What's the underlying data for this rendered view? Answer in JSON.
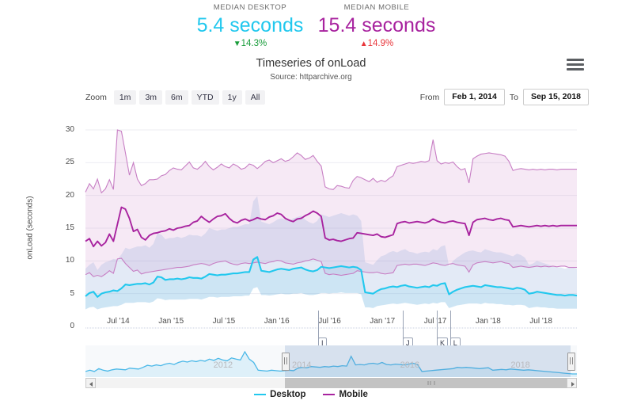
{
  "kpis": [
    {
      "name": "median-desktop",
      "label": "MEDIAN DESKTOP",
      "value": "5.4 seconds",
      "delta": "14.3%",
      "direction": "down",
      "arrow": "▼",
      "color": "#22c8ee",
      "delta_color": "#189c3a"
    },
    {
      "name": "median-mobile",
      "label": "MEDIAN MOBILE",
      "value": "15.4 seconds",
      "delta": "14.9%",
      "direction": "up",
      "arrow": "▲",
      "color": "#a8239f",
      "delta_color": "#e8353a"
    }
  ],
  "chart": {
    "title": "Timeseries of onLoad",
    "subtitle": "Source: httparchive.org",
    "menu_icon": "hamburger-menu-icon"
  },
  "rangeselector": {
    "label": "Zoom",
    "buttons": [
      "1m",
      "3m",
      "6m",
      "YTD",
      "1y",
      "All"
    ],
    "from_label": "From",
    "from_value": "Feb 1, 2014",
    "to_label": "To",
    "to_value": "Sep 15, 2018"
  },
  "navigator": {
    "years": [
      "2012",
      "2014",
      "2016",
      "2018"
    ],
    "left_handle": "navigator-left-handle",
    "right_handle": "navigator-right-handle",
    "scroll_left_icon": "arrow-left-icon",
    "scroll_right_icon": "arrow-right-icon"
  },
  "legend": [
    {
      "label": "Desktop",
      "color": "#22c8ee"
    },
    {
      "label": "Mobile",
      "color": "#a8239f"
    }
  ],
  "flags": [
    {
      "label": "I",
      "x": 0.4735
    },
    {
      "label": "J",
      "x": 0.6458
    },
    {
      "label": "K",
      "x": 0.715
    },
    {
      "label": "L",
      "x": 0.742
    }
  ],
  "chart_data": {
    "type": "line",
    "title": "Timeseries of onLoad",
    "subtitle": "Source: httparchive.org",
    "xlabel": "",
    "ylabel": "onLoad (seconds)",
    "ylim": [
      0,
      30
    ],
    "yticks": [
      0,
      5,
      10,
      15,
      20,
      25,
      30
    ],
    "grid": true,
    "legend_position": "bottom",
    "xticks": [
      "Jul '14",
      "Jan '15",
      "Jul '15",
      "Jan '16",
      "Jul '16",
      "Jan '17",
      "Jul '17",
      "Jan '18",
      "Jul '18"
    ],
    "x_start": "Feb 1, 2014",
    "x_end": "Sep 15, 2018",
    "series": [
      {
        "name": "Desktop",
        "color": "#22c8ee",
        "role": "median",
        "values": [
          4.6,
          5.1,
          5.3,
          4.5,
          5.0,
          5.2,
          5.3,
          5.5,
          5.4,
          5.8,
          6.4,
          6.3,
          6.4,
          6.5,
          6.5,
          6.6,
          6.4,
          6.7,
          7.6,
          7.5,
          7.1,
          7.2,
          7.2,
          7.3,
          7.2,
          7.3,
          7.5,
          7.4,
          7.4,
          7.3,
          7.6,
          8.0,
          7.9,
          7.8,
          7.9,
          7.9,
          8.0,
          8.1,
          8.1,
          8.2,
          8.3,
          8.3,
          10.2,
          10.6,
          8.5,
          8.4,
          8.3,
          8.5,
          8.7,
          8.8,
          8.7,
          8.6,
          8.8,
          8.9,
          9.0,
          8.7,
          8.5,
          8.4,
          8.6,
          9.1,
          9.0,
          8.9,
          9.0,
          9.1,
          9.2,
          9.1,
          9.0,
          9.1,
          9.0,
          8.6,
          5.2,
          5.1,
          5.0,
          5.4,
          5.7,
          5.8,
          6.0,
          6.1,
          6.0,
          6.2,
          6.3,
          6.1,
          6.0,
          5.9,
          6.0,
          6.1,
          6.0,
          6.3,
          6.2,
          6.5,
          6.6,
          4.9,
          5.3,
          5.6,
          5.8,
          6.0,
          6.1,
          6.2,
          6.1,
          6.0,
          6.3,
          6.2,
          6.1,
          6.0,
          6.0,
          5.9,
          5.8,
          5.7,
          5.9,
          5.8,
          5.6,
          5.0,
          5.1,
          5.3,
          5.2,
          5.1,
          5.0,
          4.9,
          4.8,
          4.8,
          4.7,
          4.8,
          4.8,
          4.7
        ]
      },
      {
        "name": "Mobile",
        "color": "#a8239f",
        "role": "median",
        "values": [
          13.0,
          13.4,
          12.2,
          13.0,
          12.3,
          12.8,
          14.1,
          13.0,
          15.6,
          18.2,
          17.9,
          16.5,
          14.5,
          14.8,
          13.6,
          13.2,
          13.9,
          14.2,
          14.3,
          14.5,
          14.6,
          14.9,
          14.7,
          15.0,
          15.1,
          15.3,
          15.4,
          15.9,
          16.1,
          16.8,
          16.3,
          15.9,
          16.4,
          16.8,
          16.9,
          17.2,
          16.5,
          16.0,
          15.8,
          16.2,
          16.4,
          16.1,
          16.3,
          16.6,
          16.4,
          16.3,
          16.7,
          16.9,
          17.3,
          17.1,
          16.5,
          16.2,
          16.0,
          16.4,
          16.5,
          16.9,
          17.2,
          17.6,
          17.3,
          16.8,
          13.5,
          13.2,
          13.3,
          13.1,
          13.0,
          13.2,
          13.4,
          13.5,
          14.3,
          14.2,
          14.1,
          14.0,
          13.9,
          14.1,
          13.7,
          13.6,
          13.8,
          14.0,
          15.7,
          15.9,
          16.0,
          15.8,
          15.9,
          16.0,
          15.9,
          15.8,
          16.0,
          16.4,
          16.1,
          15.9,
          15.8,
          16.0,
          16.1,
          15.9,
          15.8,
          15.7,
          13.9,
          15.9,
          16.3,
          16.4,
          16.5,
          16.3,
          16.2,
          16.4,
          16.5,
          16.3,
          16.2,
          15.2,
          15.3,
          15.4,
          15.3,
          15.2,
          15.3,
          15.4,
          15.3,
          15.4,
          15.3,
          15.4,
          15.3,
          15.4,
          15.4,
          15.4,
          15.4,
          15.4
        ]
      },
      {
        "name": "Mobile upper band",
        "color": "#c77ec4",
        "role": "band-upper",
        "values": [
          20.5,
          21.8,
          21.0,
          22.5,
          20.4,
          21.0,
          22.4,
          20.9,
          30.0,
          29.8,
          26.5,
          23.1,
          25.0,
          22.5,
          21.5,
          21.8,
          22.4,
          22.4,
          22.5,
          23.0,
          23.2,
          23.8,
          24.2,
          24.0,
          23.9,
          24.5,
          25.1,
          24.2,
          24.0,
          24.5,
          25.2,
          24.4,
          23.9,
          24.3,
          24.8,
          24.4,
          24.2,
          24.8,
          24.5,
          24.0,
          24.2,
          24.8,
          24.6,
          24.1,
          24.6,
          25.2,
          25.4,
          25.0,
          25.3,
          25.6,
          25.2,
          25.4,
          25.9,
          26.5,
          26.1,
          25.5,
          25.7,
          26.1,
          25.2,
          24.5,
          21.3,
          21.0,
          20.9,
          21.5,
          21.4,
          21.2,
          21.1,
          22.3,
          22.9,
          22.7,
          22.4,
          22.1,
          22.6,
          22.0,
          22.3,
          22.1,
          22.6,
          23.0,
          24.4,
          24.6,
          24.8,
          25.0,
          24.9,
          25.0,
          25.2,
          25.1,
          25.3,
          28.5,
          25.3,
          24.8,
          25.0,
          24.9,
          25.1,
          24.4,
          23.9,
          24.1,
          21.9,
          25.6,
          26.0,
          26.3,
          26.4,
          26.5,
          26.4,
          26.3,
          26.2,
          26.0,
          25.2,
          23.8,
          24.0,
          24.1,
          24.0,
          23.9,
          24.0,
          23.9,
          24.0,
          23.9,
          24.0,
          24.0,
          23.9,
          24.0,
          24.0,
          24.0,
          24.0,
          24.0
        ]
      },
      {
        "name": "Mobile lower band",
        "color": "#c77ec4",
        "role": "band-lower",
        "values": [
          7.9,
          8.2,
          7.6,
          7.8,
          7.6,
          8.0,
          8.5,
          8.1,
          10.3,
          10.4,
          9.6,
          9.0,
          8.4,
          8.6,
          8.0,
          8.2,
          8.3,
          8.4,
          8.5,
          8.6,
          8.7,
          8.8,
          8.9,
          9.0,
          9.0,
          9.1,
          9.2,
          9.4,
          9.5,
          9.6,
          9.5,
          9.3,
          9.6,
          9.8,
          9.9,
          10.0,
          9.7,
          9.5,
          9.4,
          9.6,
          9.7,
          9.6,
          9.7,
          9.8,
          9.7,
          9.6,
          9.8,
          9.9,
          10.1,
          10.0,
          9.7,
          9.6,
          9.5,
          9.7,
          9.8,
          10.0,
          10.1,
          10.3,
          10.1,
          9.9,
          8.1,
          7.9,
          8.0,
          7.9,
          7.8,
          7.9,
          8.0,
          8.1,
          8.5,
          8.4,
          8.3,
          8.2,
          8.2,
          8.3,
          8.1,
          8.0,
          8.1,
          8.2,
          9.3,
          9.4,
          9.5,
          9.4,
          9.5,
          9.5,
          9.4,
          9.3,
          9.5,
          9.7,
          9.6,
          9.4,
          9.3,
          9.5,
          9.6,
          9.4,
          9.3,
          9.2,
          8.3,
          9.4,
          9.7,
          9.8,
          9.9,
          9.8,
          9.7,
          9.8,
          9.9,
          9.7,
          9.6,
          9.0,
          9.1,
          9.2,
          9.1,
          9.0,
          9.1,
          9.2,
          9.1,
          9.2,
          9.1,
          9.2,
          9.1,
          9.2,
          9.2,
          9.0,
          9.0,
          9.0
        ]
      },
      {
        "name": "Desktop upper band",
        "color": "#9db7e0",
        "role": "band-upper",
        "values": [
          8.8,
          9.4,
          9.8,
          8.6,
          9.4,
          9.8,
          10.0,
          10.3,
          10.2,
          11.0,
          12.0,
          11.8,
          12.0,
          12.2,
          12.2,
          12.4,
          12.0,
          12.6,
          14.2,
          14.0,
          13.3,
          13.5,
          13.5,
          13.7,
          13.5,
          13.7,
          14.0,
          13.9,
          13.9,
          13.7,
          14.2,
          15.0,
          14.8,
          14.6,
          14.8,
          14.8,
          15.0,
          15.2,
          15.2,
          15.4,
          15.6,
          15.6,
          19.1,
          19.9,
          16.0,
          15.8,
          15.6,
          15.9,
          16.3,
          16.5,
          16.3,
          16.1,
          16.5,
          16.7,
          16.9,
          16.3,
          15.9,
          15.7,
          16.1,
          17.1,
          16.9,
          16.7,
          16.9,
          17.1,
          17.3,
          17.1,
          16.9,
          17.1,
          16.9,
          16.1,
          9.8,
          9.6,
          9.4,
          10.1,
          10.7,
          10.9,
          11.3,
          11.5,
          11.3,
          11.6,
          11.8,
          11.4,
          11.3,
          11.1,
          11.3,
          11.4,
          11.3,
          11.8,
          11.6,
          12.2,
          12.4,
          9.2,
          10.0,
          10.5,
          10.9,
          11.3,
          11.5,
          11.6,
          11.4,
          11.3,
          11.8,
          11.6,
          11.4,
          11.3,
          11.3,
          11.1,
          10.9,
          10.7,
          11.1,
          10.9,
          10.5,
          9.4,
          9.6,
          10.0,
          9.8,
          9.6,
          9.4,
          9.2,
          9.0,
          9.0,
          8.8,
          9.0,
          9.0,
          8.8
        ]
      },
      {
        "name": "Desktop lower band",
        "color": "#9db7e0",
        "role": "band-lower",
        "values": [
          2.6,
          2.9,
          3.0,
          2.6,
          2.8,
          2.9,
          3.0,
          3.1,
          3.1,
          3.3,
          3.6,
          3.6,
          3.6,
          3.7,
          3.7,
          3.7,
          3.6,
          3.8,
          4.3,
          4.2,
          4.0,
          4.1,
          4.1,
          4.1,
          4.1,
          4.1,
          4.2,
          4.2,
          4.2,
          4.1,
          4.3,
          4.5,
          4.5,
          4.4,
          4.5,
          4.5,
          4.5,
          4.6,
          4.6,
          4.6,
          4.7,
          4.7,
          5.8,
          6.0,
          4.8,
          4.8,
          4.7,
          4.8,
          4.9,
          5.0,
          4.9,
          4.9,
          5.0,
          5.0,
          5.1,
          4.9,
          4.8,
          4.8,
          4.9,
          5.1,
          5.1,
          5.0,
          5.1,
          5.1,
          5.2,
          5.1,
          5.1,
          5.1,
          5.1,
          4.9,
          2.9,
          2.9,
          2.8,
          3.1,
          3.2,
          3.3,
          3.4,
          3.5,
          3.4,
          3.5,
          3.6,
          3.5,
          3.4,
          3.3,
          3.4,
          3.5,
          3.4,
          3.6,
          3.5,
          3.7,
          3.7,
          2.8,
          3.0,
          3.2,
          3.3,
          3.4,
          3.5,
          3.5,
          3.5,
          3.4,
          3.6,
          3.5,
          3.5,
          3.4,
          3.4,
          3.3,
          3.3,
          3.2,
          3.3,
          3.3,
          3.2,
          2.8,
          2.9,
          3.0,
          2.9,
          2.9,
          2.8,
          2.8,
          2.7,
          2.7,
          2.7,
          2.7,
          2.7,
          2.7
        ]
      }
    ],
    "navigator_series": {
      "name": "Desktop (overview)",
      "color": "#4ab8e8",
      "values": [
        2.6,
        2.9,
        2.6,
        3.3,
        2.9,
        2.7,
        3.0,
        3.2,
        3.1,
        3.0,
        3.4,
        3.3,
        3.2,
        3.6,
        4.1,
        3.9,
        4.2,
        4.0,
        4.4,
        4.6,
        4.3,
        4.8,
        5.1,
        4.9,
        5.2,
        5.0,
        5.3,
        5.1,
        5.6,
        5.3,
        5.8,
        5.4,
        5.2,
        5.9,
        5.6,
        5.4,
        7.4,
        5.6,
        4.8,
        2.9,
        2.8,
        2.7,
        2.9,
        2.8,
        2.7,
        2.8,
        2.9,
        2.8,
        3.4,
        3.6,
        3.5,
        3.8,
        3.7,
        3.6,
        3.8,
        3.7,
        3.9,
        3.8,
        4.0,
        3.9,
        6.3,
        4.2,
        4.3,
        4.2,
        4.5,
        4.6,
        4.4,
        4.8,
        4.3,
        4.2,
        4.4,
        4.3,
        4.2,
        4.4,
        4.6,
        4.3,
        2.6,
        2.7,
        2.8,
        2.9,
        3.0,
        3.1,
        3.2,
        3.3,
        3.6,
        3.5,
        3.6,
        3.5,
        3.4,
        3.3,
        3.4,
        3.5,
        2.9,
        3.0,
        3.1,
        3.0,
        3.2,
        3.1,
        3.0,
        2.9,
        3.0,
        2.9,
        2.8,
        2.7,
        2.6,
        2.5,
        2.4,
        2.3,
        2.2,
        2.1,
        2.0,
        2.0
      ]
    }
  }
}
